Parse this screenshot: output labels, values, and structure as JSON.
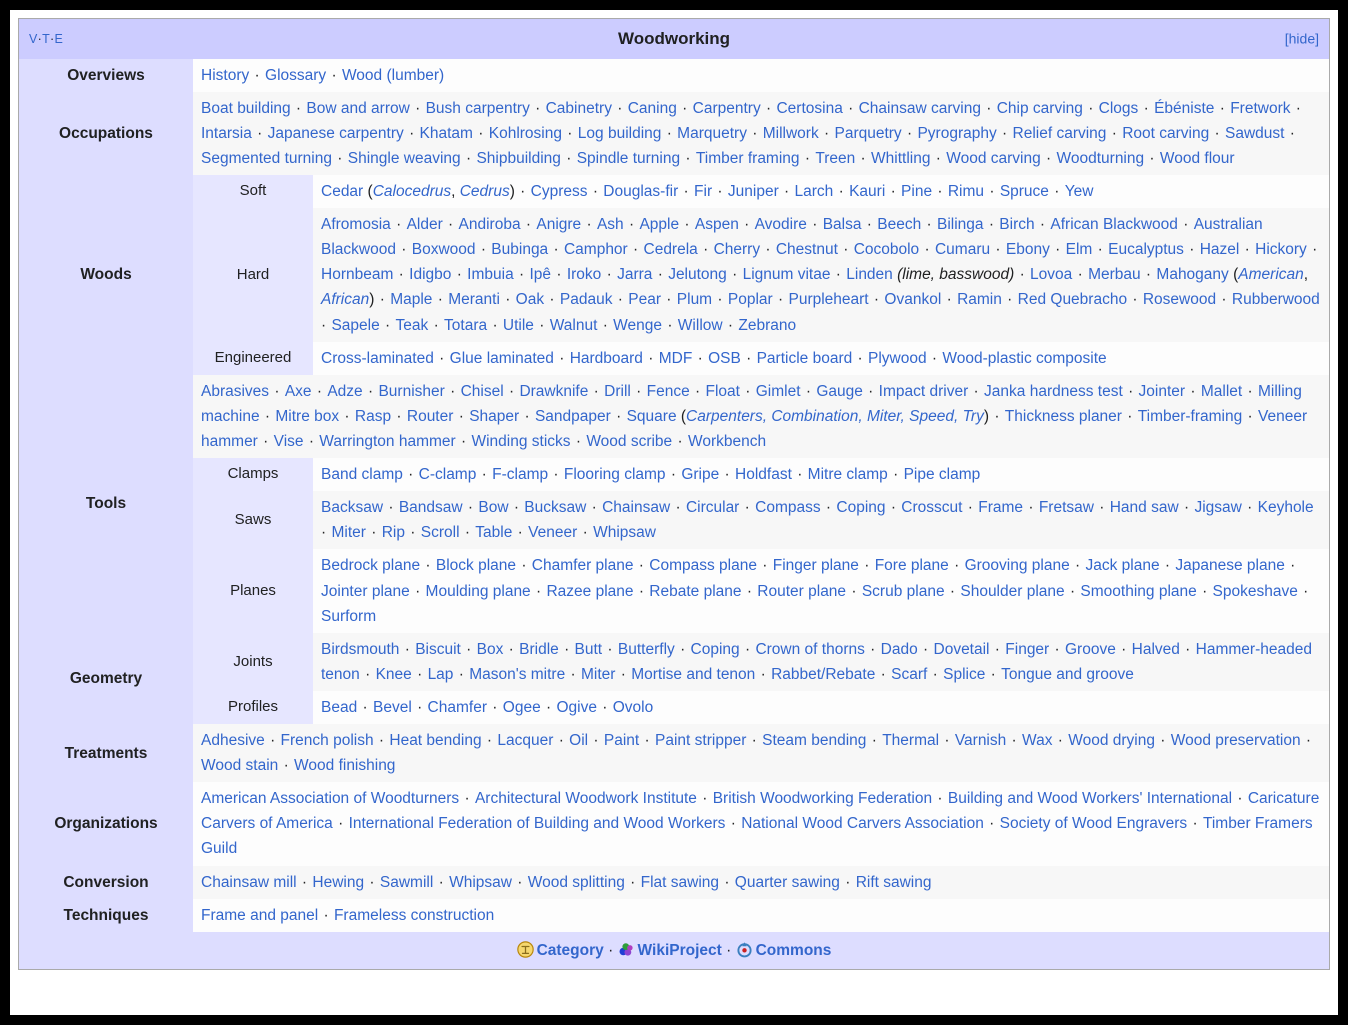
{
  "navbox": {
    "title": "Woodworking",
    "vte": {
      "v": "V",
      "t": "T",
      "e": "E",
      "sep": "·"
    },
    "hide_label": "[hide]",
    "separator": "·",
    "groups": [
      {
        "label": "Overviews",
        "items": [
          {
            "text": "History"
          },
          {
            "text": "Glossary"
          },
          {
            "text": "Wood (lumber)"
          }
        ]
      },
      {
        "label": "Occupations",
        "items": [
          {
            "text": "Boat building"
          },
          {
            "text": "Bow and arrow"
          },
          {
            "text": "Bush carpentry"
          },
          {
            "text": "Cabinetry"
          },
          {
            "text": "Caning"
          },
          {
            "text": "Carpentry"
          },
          {
            "text": "Certosina"
          },
          {
            "text": "Chainsaw carving"
          },
          {
            "text": "Chip carving"
          },
          {
            "text": "Clogs"
          },
          {
            "text": "Ébéniste"
          },
          {
            "text": "Fretwork"
          },
          {
            "text": "Intarsia"
          },
          {
            "text": "Japanese carpentry"
          },
          {
            "text": "Khatam"
          },
          {
            "text": "Kohlrosing"
          },
          {
            "text": "Log building"
          },
          {
            "text": "Marquetry"
          },
          {
            "text": "Millwork"
          },
          {
            "text": "Parquetry"
          },
          {
            "text": "Pyrography"
          },
          {
            "text": "Relief carving"
          },
          {
            "text": "Root carving"
          },
          {
            "text": "Sawdust"
          },
          {
            "text": "Segmented turning"
          },
          {
            "text": "Shingle weaving"
          },
          {
            "text": "Shipbuilding"
          },
          {
            "text": "Spindle turning"
          },
          {
            "text": "Timber framing"
          },
          {
            "text": "Treen"
          },
          {
            "text": "Whittling"
          },
          {
            "text": "Wood carving"
          },
          {
            "text": "Woodturning"
          },
          {
            "text": "Wood flour"
          }
        ]
      },
      {
        "label": "Woods",
        "subgroups": [
          {
            "label": "Soft",
            "items": [
              {
                "text": "Cedar ",
                "suffix_paren": [
                  "Calocedrus",
                  "Cedrus"
                ]
              },
              {
                "text": "Cypress"
              },
              {
                "text": "Douglas-fir"
              },
              {
                "text": "Fir"
              },
              {
                "text": "Juniper"
              },
              {
                "text": "Larch"
              },
              {
                "text": "Kauri"
              },
              {
                "text": "Pine"
              },
              {
                "text": "Rimu"
              },
              {
                "text": "Spruce"
              },
              {
                "text": "Yew"
              }
            ]
          },
          {
            "label": "Hard",
            "items": [
              {
                "text": "Afromosia"
              },
              {
                "text": "Alder"
              },
              {
                "text": "Andiroba"
              },
              {
                "text": "Anigre"
              },
              {
                "text": "Ash"
              },
              {
                "text": "Apple"
              },
              {
                "text": "Aspen"
              },
              {
                "text": "Avodire"
              },
              {
                "text": "Balsa"
              },
              {
                "text": "Beech"
              },
              {
                "text": "Bilinga"
              },
              {
                "text": "Birch"
              },
              {
                "text": "African Blackwood"
              },
              {
                "text": "Australian Blackwood"
              },
              {
                "text": "Boxwood"
              },
              {
                "text": "Bubinga"
              },
              {
                "text": "Camphor"
              },
              {
                "text": "Cedrela"
              },
              {
                "text": "Cherry"
              },
              {
                "text": "Chestnut"
              },
              {
                "text": "Cocobolo"
              },
              {
                "text": "Cumaru"
              },
              {
                "text": "Ebony"
              },
              {
                "text": "Elm"
              },
              {
                "text": "Eucalyptus"
              },
              {
                "text": "Hazel"
              },
              {
                "text": "Hickory"
              },
              {
                "text": "Hornbeam"
              },
              {
                "text": "Idigbo"
              },
              {
                "text": "Imbuia"
              },
              {
                "text": "Ipê"
              },
              {
                "text": "Iroko"
              },
              {
                "text": "Jarra"
              },
              {
                "text": "Jelutong"
              },
              {
                "text": "Lignum vitae"
              },
              {
                "text": "Linden",
                "italic_note": "(lime, basswood)"
              },
              {
                "text": "Lovoa"
              },
              {
                "text": "Merbau"
              },
              {
                "text": "Mahogany ",
                "suffix_paren": [
                  "American",
                  "African"
                ]
              },
              {
                "text": "Maple"
              },
              {
                "text": "Meranti"
              },
              {
                "text": "Oak"
              },
              {
                "text": "Padauk"
              },
              {
                "text": "Pear"
              },
              {
                "text": "Plum"
              },
              {
                "text": "Poplar"
              },
              {
                "text": "Purpleheart"
              },
              {
                "text": "Ovankol"
              },
              {
                "text": "Ramin"
              },
              {
                "text": "Red Quebracho"
              },
              {
                "text": "Rosewood"
              },
              {
                "text": "Rubberwood"
              },
              {
                "text": "Sapele"
              },
              {
                "text": "Teak"
              },
              {
                "text": "Totara"
              },
              {
                "text": "Utile"
              },
              {
                "text": "Walnut"
              },
              {
                "text": "Wenge"
              },
              {
                "text": "Willow"
              },
              {
                "text": "Zebrano"
              }
            ]
          },
          {
            "label": "Engineered",
            "items": [
              {
                "text": "Cross-laminated"
              },
              {
                "text": "Glue laminated"
              },
              {
                "text": "Hardboard"
              },
              {
                "text": "MDF"
              },
              {
                "text": "OSB"
              },
              {
                "text": "Particle board"
              },
              {
                "text": "Plywood"
              },
              {
                "text": "Wood-plastic composite"
              }
            ]
          }
        ]
      },
      {
        "label": "Tools",
        "items": [
          {
            "text": "Abrasives"
          },
          {
            "text": "Axe"
          },
          {
            "text": "Adze"
          },
          {
            "text": "Burnisher"
          },
          {
            "text": "Chisel"
          },
          {
            "text": "Drawknife"
          },
          {
            "text": "Drill"
          },
          {
            "text": "Fence"
          },
          {
            "text": "Float"
          },
          {
            "text": "Gimlet"
          },
          {
            "text": "Gauge"
          },
          {
            "text": "Impact driver"
          },
          {
            "text": "Janka hardness test"
          },
          {
            "text": "Jointer"
          },
          {
            "text": "Mallet"
          },
          {
            "text": "Milling machine"
          },
          {
            "text": "Mitre box"
          },
          {
            "text": "Rasp"
          },
          {
            "text": "Router"
          },
          {
            "text": "Shaper"
          },
          {
            "text": "Sandpaper"
          },
          {
            "text": "Square ",
            "suffix_paren": [
              "Carpenters, Combination, Miter, Speed, Try"
            ]
          },
          {
            "text": "Thickness planer"
          },
          {
            "text": "Timber-framing"
          },
          {
            "text": "Veneer hammer"
          },
          {
            "text": "Vise"
          },
          {
            "text": "Warrington hammer"
          },
          {
            "text": "Winding sticks"
          },
          {
            "text": "Wood scribe"
          },
          {
            "text": "Workbench"
          }
        ],
        "subgroups": [
          {
            "label": "Clamps",
            "items": [
              {
                "text": "Band clamp"
              },
              {
                "text": "C-clamp"
              },
              {
                "text": "F-clamp"
              },
              {
                "text": "Flooring clamp"
              },
              {
                "text": "Gripe"
              },
              {
                "text": "Holdfast"
              },
              {
                "text": "Mitre clamp"
              },
              {
                "text": "Pipe clamp"
              }
            ]
          },
          {
            "label": "Saws",
            "items": [
              {
                "text": "Backsaw"
              },
              {
                "text": "Bandsaw"
              },
              {
                "text": "Bow"
              },
              {
                "text": "Bucksaw"
              },
              {
                "text": "Chainsaw"
              },
              {
                "text": "Circular"
              },
              {
                "text": "Compass"
              },
              {
                "text": "Coping"
              },
              {
                "text": "Crosscut"
              },
              {
                "text": "Frame"
              },
              {
                "text": "Fretsaw"
              },
              {
                "text": "Hand saw"
              },
              {
                "text": "Jigsaw"
              },
              {
                "text": "Keyhole"
              },
              {
                "text": "Miter"
              },
              {
                "text": "Rip"
              },
              {
                "text": "Scroll"
              },
              {
                "text": "Table"
              },
              {
                "text": "Veneer"
              },
              {
                "text": "Whipsaw"
              }
            ]
          },
          {
            "label": "Planes",
            "items": [
              {
                "text": "Bedrock plane"
              },
              {
                "text": "Block plane"
              },
              {
                "text": "Chamfer plane"
              },
              {
                "text": "Compass plane"
              },
              {
                "text": "Finger plane"
              },
              {
                "text": "Fore plane"
              },
              {
                "text": "Grooving plane"
              },
              {
                "text": "Jack plane"
              },
              {
                "text": "Japanese plane"
              },
              {
                "text": "Jointer plane"
              },
              {
                "text": "Moulding plane"
              },
              {
                "text": "Razee plane"
              },
              {
                "text": "Rebate plane"
              },
              {
                "text": "Router plane"
              },
              {
                "text": "Scrub plane"
              },
              {
                "text": "Shoulder plane"
              },
              {
                "text": "Smoothing plane"
              },
              {
                "text": "Spokeshave"
              },
              {
                "text": "Surform"
              }
            ]
          }
        ]
      },
      {
        "label": "Geometry",
        "subgroups": [
          {
            "label": "Joints",
            "items": [
              {
                "text": "Birdsmouth"
              },
              {
                "text": "Biscuit"
              },
              {
                "text": "Box"
              },
              {
                "text": "Bridle"
              },
              {
                "text": "Butt"
              },
              {
                "text": "Butterfly"
              },
              {
                "text": "Coping"
              },
              {
                "text": "Crown of thorns"
              },
              {
                "text": "Dado"
              },
              {
                "text": "Dovetail"
              },
              {
                "text": "Finger"
              },
              {
                "text": "Groove"
              },
              {
                "text": "Halved"
              },
              {
                "text": "Hammer-headed tenon"
              },
              {
                "text": "Knee"
              },
              {
                "text": "Lap"
              },
              {
                "text": "Mason's mitre"
              },
              {
                "text": "Miter"
              },
              {
                "text": "Mortise and tenon"
              },
              {
                "text": "Rabbet/Rebate"
              },
              {
                "text": "Scarf"
              },
              {
                "text": "Splice"
              },
              {
                "text": "Tongue and groove"
              }
            ]
          },
          {
            "label": "Profiles",
            "items": [
              {
                "text": "Bead"
              },
              {
                "text": "Bevel"
              },
              {
                "text": "Chamfer"
              },
              {
                "text": "Ogee"
              },
              {
                "text": "Ogive"
              },
              {
                "text": "Ovolo"
              }
            ]
          }
        ]
      },
      {
        "label": "Treatments",
        "items": [
          {
            "text": "Adhesive"
          },
          {
            "text": "French polish"
          },
          {
            "text": "Heat bending"
          },
          {
            "text": "Lacquer"
          },
          {
            "text": "Oil"
          },
          {
            "text": "Paint"
          },
          {
            "text": "Paint stripper"
          },
          {
            "text": "Steam bending"
          },
          {
            "text": "Thermal"
          },
          {
            "text": "Varnish"
          },
          {
            "text": "Wax"
          },
          {
            "text": "Wood drying"
          },
          {
            "text": "Wood preservation"
          },
          {
            "text": "Wood stain"
          },
          {
            "text": "Wood finishing"
          }
        ]
      },
      {
        "label": "Organizations",
        "items": [
          {
            "text": "American Association of Woodturners"
          },
          {
            "text": "Architectural Woodwork Institute"
          },
          {
            "text": "British Woodworking Federation"
          },
          {
            "text": "Building and Wood Workers' International"
          },
          {
            "text": "Caricature Carvers of America"
          },
          {
            "text": "International Federation of Building and Wood Workers"
          },
          {
            "text": "National Wood Carvers Association"
          },
          {
            "text": "Society of Wood Engravers"
          },
          {
            "text": "Timber Framers Guild"
          }
        ]
      },
      {
        "label": "Conversion",
        "items": [
          {
            "text": "Chainsaw mill"
          },
          {
            "text": "Hewing"
          },
          {
            "text": "Sawmill"
          },
          {
            "text": "Whipsaw"
          },
          {
            "text": "Wood splitting"
          },
          {
            "text": "Flat sawing"
          },
          {
            "text": "Quarter sawing"
          },
          {
            "text": "Rift sawing"
          }
        ]
      },
      {
        "label": "Techniques",
        "items": [
          {
            "text": "Frame and panel"
          },
          {
            "text": "Frameless construction"
          }
        ]
      }
    ],
    "below": [
      {
        "icon": "category-icon",
        "label": "Category"
      },
      {
        "icon": "wikiproject-puzzle-icon",
        "label": "WikiProject"
      },
      {
        "icon": "commons-icon",
        "label": "Commons"
      }
    ]
  },
  "colors": {
    "title_bg": "#ccccff",
    "group_bg": "#ddddff",
    "subgroup_bg": "#e6e6ff",
    "list_odd_bg": "#fdfdfd",
    "list_even_bg": "#f7f7f7",
    "link": "#3366cc",
    "border": "#aaaaaa"
  }
}
